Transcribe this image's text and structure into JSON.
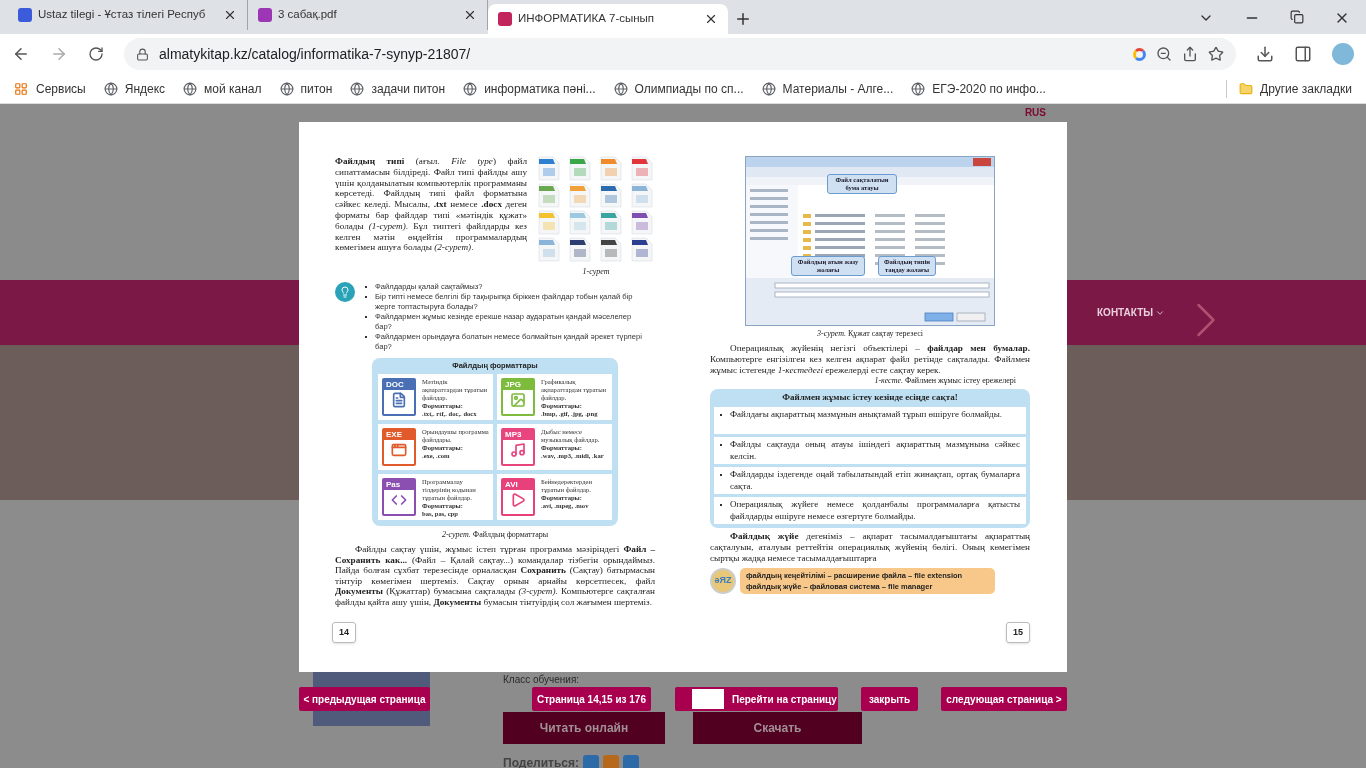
{
  "browser": {
    "tabs": [
      {
        "title": "Ustaz tilegi - Ұстаз тілегі Респуб",
        "selected": false
      },
      {
        "title": "3 сабақ.pdf",
        "selected": false
      },
      {
        "title": "ИНФОРМАТИКА 7-сынып",
        "selected": true
      }
    ],
    "url": "almatykitap.kz/catalog/informatika-7-synyp-21807/",
    "apps_label": "Сервисы",
    "bookmarks": [
      "Яндекс",
      "мой канал",
      "питон",
      "задачи питон",
      "информатика пәні...",
      "Олимпиады по сп...",
      "Материалы - Алге...",
      "ЕГЭ-2020 по инфо..."
    ],
    "other_bookmarks": "Другие закладки"
  },
  "site": {
    "lang": "RUS",
    "menu_item": "КОНТАКТЫ",
    "class_label": "Класс обучения:",
    "read_button": "Читать онлайн",
    "download_button": "Скачать",
    "share_label": "Поделиться:"
  },
  "book": {
    "left_page": {
      "intro": "**Файлдың типі** (ағыл. *File type*) файл сипаттамасын білдіреді. Файл типі файлды ашу үшін қолданылатын компьютерлік программаны көрсетеді. Файлдың типі файл форматына сәйкес келеді. Мысалы, **.txt** немесе **.docx** деген форматы бар файлдар типі «мәтіндік құжат» болады *(1-сурет)*. Бұл типтегі файлдарды кез келген мәтін өңдейтін программалардың көмегімен ашуға болады *(2-сурет)*.",
      "fig1_caption": "1-сурет",
      "questions": [
        "Файлдарды қалай сақтаймыз?",
        "Бір типті немесе белгілі бір тақырыпқа біріккен файлдар тобын қалай бір жерге топтастыруға болады?",
        "Файлдармен жұмыс кезінде ерекше назар аударатын қандай мәселелер бар?",
        "Файлдармен орындауға болатын немесе болмайтын қандай әрекет түрлері бар?"
      ],
      "formats_title": "Файлдың форматтары",
      "formats": [
        {
          "badge": "DOC",
          "kind": "text",
          "color": "#4a6fb5",
          "description": "Мәтіндік ақпараттардан тұратын файлдар.",
          "label": "Форматтары:",
          "extensions": ".txt,. rtf,. doc,. docx"
        },
        {
          "badge": "JPG",
          "kind": "image",
          "color": "#7dbb3c",
          "description": "Графикалық ақпараттардан тұратын файлдар.",
          "label": "Форматтары:",
          "extensions": ".bmp, .gif, .jpg, .png"
        },
        {
          "badge": "EXE",
          "kind": "program",
          "color": "#e05a2b",
          "description": "Орындаушы программа файлдары.",
          "label": "Форматтары:",
          "extensions": ".exe, .com"
        },
        {
          "badge": "MP3",
          "kind": "audio",
          "color": "#e8457f",
          "description": "Дыбыс немесе музыкалық файлдар.",
          "label": "Форматтары:",
          "extensions": ".wav, .mp3, .midi, .kar"
        },
        {
          "badge": "Pas",
          "kind": "code",
          "color": "#8a4fb0",
          "description": "Программалау тілдерінің кодынан тұратын файлдар.",
          "label": "Форматтары:",
          "extensions": "bas, pas, cpp"
        },
        {
          "badge": "AVI",
          "kind": "video",
          "color": "#e8407a",
          "description": "Бейнедеректерден тұратын файлдар.",
          "label": "Форматтары:",
          "extensions": ".avi, .mpeg, .mov"
        }
      ],
      "fig2_caption": "*2-сурет.* Файлдың форматтары",
      "body": "Файлды сақтау үшін, жұмыс істеп тұрған программа мәзіріндегі **Файл – Сохранить как...** (Файл – Қалай сақтау...) командалар тізбегін орындаймыз. Пайда болған сұхбат терезесінде орналасқан **Сохранить** (Сақтау) батырмасын тінтуір көмегімен шертеміз. Сақтау орнын арнайы көрсетпесек, файл **Документы** (Құжаттар) бумасына сақталады *(3-сурет)*. Компьютерге сақталған файлды қайта ашу үшін, **Документы** бумасын тінтуірдің сол жағымен шертеміз.",
      "page_number": "14"
    },
    "right_page": {
      "dialog_callouts": [
        "Файл сақталатын бума атауы",
        "Файлдың атын жазу жолағы",
        "Файлдың типін таңдау жолағы"
      ],
      "fig3_caption": "*3-сурет.* Құжат сақтау терезесі",
      "intro": "Операциялық жүйенің негізгі объектілері – **файлдар мен бумалар.** Компьютерге енгізілген кез келген ақпарат файл ретінде сақталады. Файлмен жұмыс істегенде *1-кестедегі* ережелерді есте сақтау керек.",
      "table_caption": "*1-кесте.* Файлмен жұмыс істеу ережелері",
      "rules_title": "Файлмен жұмыс істеу кезінде есіңде сақта!",
      "rules": [
        "Файлдағы ақпараттың мазмұнын анықтамай тұрып өшіруге болмайды.",
        "Файлды сақтауда оның атауы ішіндегі ақпараттың мазмұнына сәйкес келсін.",
        "Файлдарды іздегенде оңай табылатындай етіп жинақтап, ортақ бумаларға сақта.",
        "Операциялық жүйеге немесе қолданбалы программаларға қатысты файлдарды өшіруге немесе өзгертуге болмайды."
      ],
      "body": "**Файлдық жүйе** дегеніміз – ақпарат тасымалдағыштағы ақпараттың сақталуын, аталуын реттейтін операциялық жүйенің бөлігі. Оның көмегімен сыртқы жадқа немесе тасымалдағыштарға",
      "glossary_badge": "әЯZ",
      "glossary": [
        "файлдың кеңейтілімі – расширение файла – file extension",
        "файлдық жүйе – файловая система – file manager"
      ],
      "page_number": "15"
    }
  },
  "viewer_nav": {
    "prev": "< предыдущая страница",
    "page_info": "Страница **14,15** из 176",
    "goto": "Перейти на страницу",
    "close": "закрыть",
    "next": "следующая страница >"
  }
}
